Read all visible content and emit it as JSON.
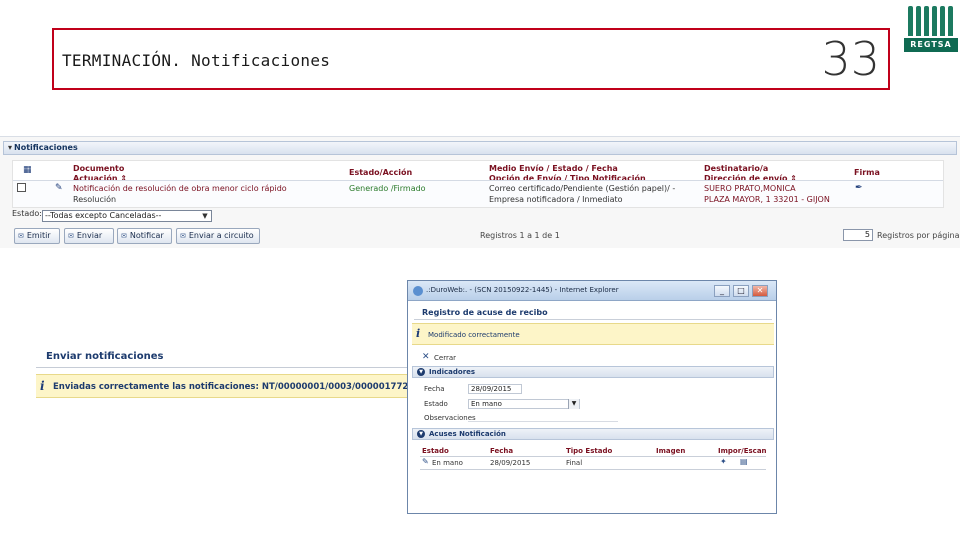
{
  "slide": {
    "title": "TERMINACIÓN. Notificaciones",
    "number": "33",
    "logo_text": "REGTSA"
  },
  "notifications": {
    "panel_title": "Notificaciones",
    "columns": {
      "documento": "Documento",
      "actuacion": "Actuación",
      "estado": "Estado/Acción",
      "medio_line1": "Medio Envío / Estado / Fecha",
      "medio_line2": "Opción de Envío / Tipo Notificación",
      "destinatario_line1": "Destinatario/a",
      "destinatario_line2": "Dirección de envío",
      "firma": "Firma"
    },
    "row": {
      "documento": "Notificación de resolución de obra menor ciclo rápido",
      "actuacion": "Resolución",
      "estado": "Generado /Firmado",
      "medio_line1": "Correo certificado/Pendiente (Gestión papel)/ -",
      "medio_line2": "Empresa notificadora / Inmediato",
      "destinatario_line1": "SUERO PRATO,MONICA",
      "destinatario_line2": "PLAZA MAYOR, 1 33201 - GIJON"
    },
    "filter": {
      "label": "Estado:",
      "value": "--Todas excepto Canceladas--"
    },
    "buttons": {
      "emitir": "Emitir",
      "enviar": "Enviar",
      "notificar": "Notificar",
      "enviar_circuito": "Enviar a circuito"
    },
    "pagination": {
      "text": "Registros 1 a 1 de 1",
      "per_page_value": "5",
      "per_page_label": "Registros por página"
    }
  },
  "enviar_panel": {
    "title": "Enviar notificaciones",
    "message": "Enviadas correctamente las notificaciones: NT/00000001/0003/000001772"
  },
  "ie_window": {
    "title": ".:DuroWeb:. - (SCN 20150922-1445) - Internet Explorer",
    "dialog_title": "Registro de acuse de recibo",
    "message": "Modificado correctamente",
    "close_label": "Cerrar",
    "indicadores_title": "Indicadores",
    "fecha_label": "Fecha",
    "fecha_value": "28/09/2015",
    "estado_label": "Estado",
    "estado_value": "En mano",
    "observaciones_label": "Observaciones",
    "acuses_title": "Acuses Notificación",
    "ack_columns": {
      "estado": "Estado",
      "fecha": "Fecha",
      "tipo": "Tipo Estado",
      "imagen": "Imagen",
      "impor": "Impor/Escan"
    },
    "ack_row": {
      "estado": "En mano",
      "fecha": "28/09/2015",
      "tipo": "Final"
    },
    "controls": {
      "minimize": "_",
      "maximize": "□",
      "close": "✕"
    }
  },
  "colors": {
    "title_border": "#c0001a",
    "header_red": "#7a1020",
    "status_green": "#2a7a2a",
    "info_yellow": "#fdf5c8",
    "link_blue": "#1d3b6e"
  }
}
